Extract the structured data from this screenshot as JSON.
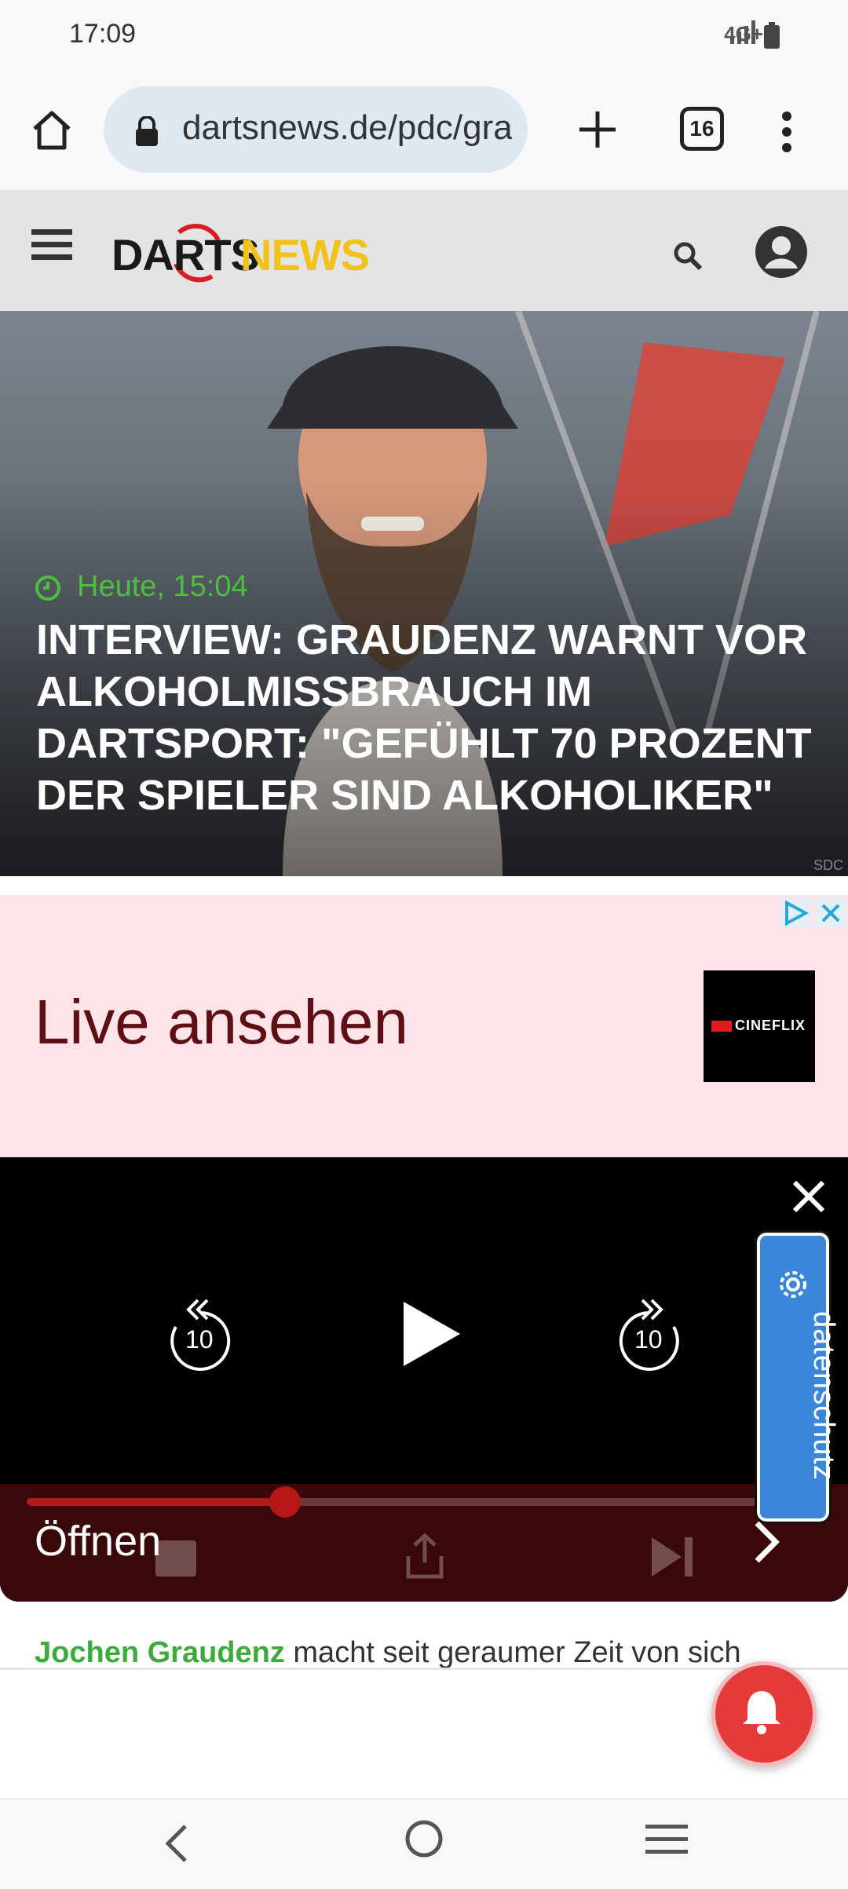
{
  "status_bar": {
    "time": "17:09",
    "network": "4G+",
    "icons": [
      "signal-icon",
      "battery-icon"
    ]
  },
  "browser": {
    "url": "dartsnews.de/pdc/gra",
    "tab_count": "16",
    "icons": [
      "home-icon",
      "lock-icon",
      "plus-icon",
      "tabs-icon",
      "more-vertical-icon"
    ]
  },
  "site": {
    "logo_part1": "DARTS",
    "logo_part2": "NEWS",
    "icons": [
      "menu-icon",
      "search-icon",
      "account-icon"
    ]
  },
  "hero": {
    "date": "Heute, 15:04",
    "title": "Interview: Graudenz warnt vor Alkoholmissbrauch im Dartsport: \"Gefühlt 70 Prozent der Spieler sind Alkoholiker\"",
    "credit": "SDC"
  },
  "ad": {
    "headline": "Live ansehen",
    "brand": "CINEFLIX"
  },
  "video": {
    "rewind_seconds": "10",
    "forward_seconds": "10",
    "progress": 0.35,
    "open_label": "Öffnen",
    "datenschutz_label": "datenschutz"
  },
  "article": {
    "link_text": "Jochen Graudenz",
    "text": " macht seit geraumer Zeit von sich"
  },
  "colors": {
    "accent_green": "#4cbf3c",
    "logo_yellow": "#f3c11a",
    "ad_bg": "#fde4e8",
    "ad_text": "#5d0f13",
    "progress_red": "#b01a1a",
    "bell_red": "#e43a3a",
    "datenschutz_blue": "#3b86d9"
  }
}
